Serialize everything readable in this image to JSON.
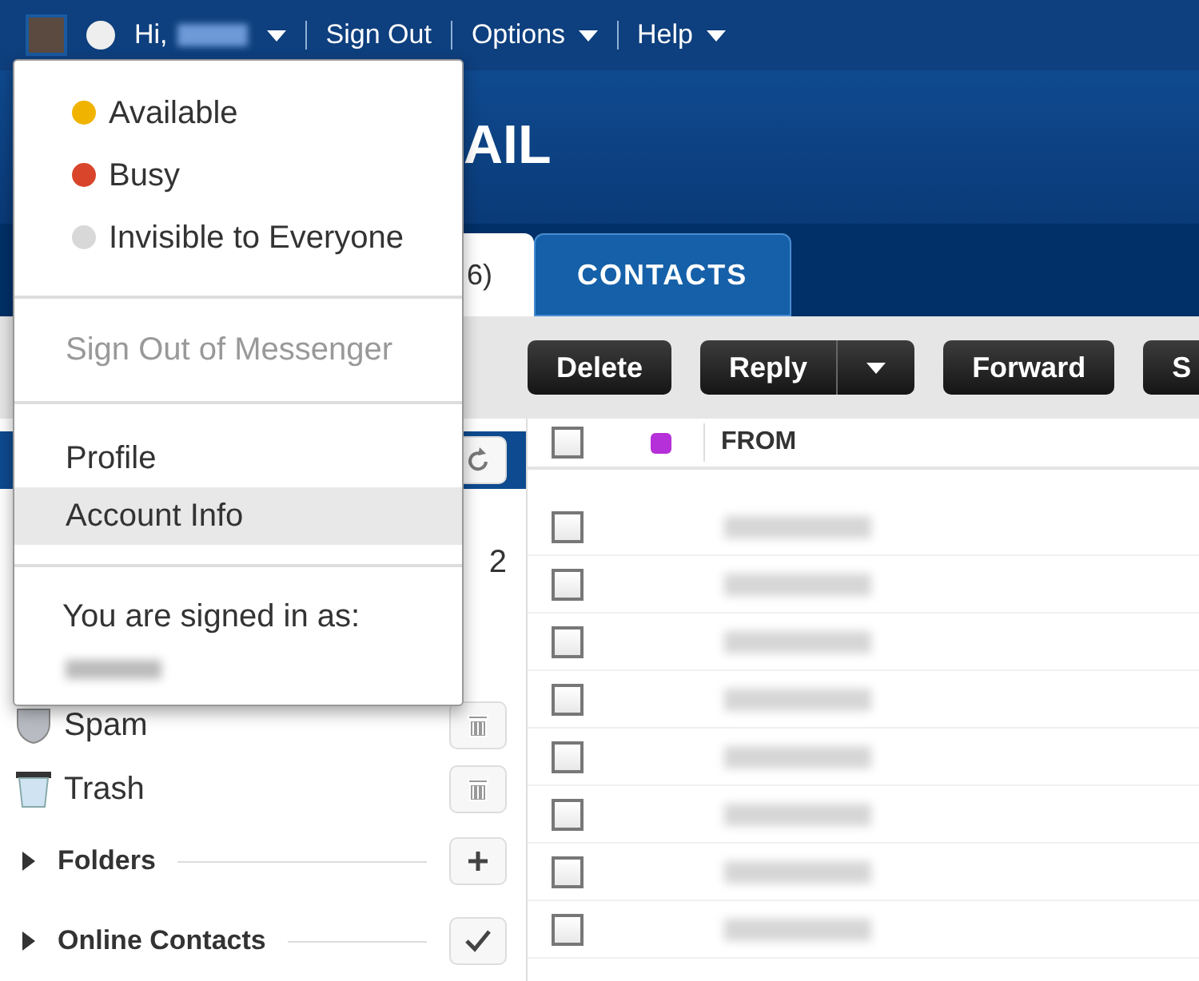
{
  "top_bar": {
    "greeting": "Hi,",
    "links": [
      {
        "label": "Sign Out",
        "dropdown": false
      },
      {
        "label": "Options",
        "dropdown": true
      },
      {
        "label": "Help",
        "dropdown": true
      }
    ]
  },
  "header": {
    "title": "AIL"
  },
  "tabs": [
    {
      "label": "6)",
      "selected": true
    },
    {
      "label": "CONTACTS",
      "selected": false
    }
  ],
  "toolbar": [
    {
      "label": "Delete",
      "split": false
    },
    {
      "label": "Reply",
      "split": true
    },
    {
      "label": "Forward",
      "split": false
    },
    {
      "label": "S",
      "split": false
    }
  ],
  "sidebar": {
    "count": "2",
    "folders": [
      {
        "label": "Spam",
        "kind": "shield"
      },
      {
        "label": "Trash",
        "kind": "bin"
      }
    ],
    "sections": [
      {
        "label": "Folders",
        "kind": "add"
      },
      {
        "label": "Online Contacts",
        "kind": "check"
      }
    ]
  },
  "table": {
    "select_all_checked": false,
    "columns": [
      "FROM"
    ],
    "rows": [
      {
        "checked": false
      },
      {
        "checked": false
      },
      {
        "checked": false
      },
      {
        "checked": false
      },
      {
        "checked": false
      },
      {
        "checked": false
      },
      {
        "checked": false
      },
      {
        "checked": false
      }
    ]
  },
  "status_menu": {
    "statuses": [
      {
        "label": "Available",
        "color": "#f0b400"
      },
      {
        "label": "Busy",
        "color": "#d9452b"
      },
      {
        "label": "Invisible to Everyone",
        "color": "#d8d8d8"
      }
    ],
    "sign_out": {
      "label": "Sign Out of Messenger",
      "disabled": true
    },
    "links": [
      {
        "label": "Profile",
        "selected": false
      },
      {
        "label": "Account Info",
        "selected": true
      }
    ],
    "signed_in_label": "You are signed in as:"
  }
}
